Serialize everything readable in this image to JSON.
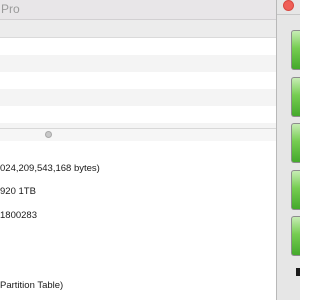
{
  "window": {
    "title": "Pro"
  },
  "info": {
    "lines": [
      "024,209,543,168 bytes)",
      "920 1TB",
      "1800283",
      " Partition Table)"
    ]
  },
  "side_panel": {
    "buttons": [
      "green-button-1",
      "green-button-2",
      "green-button-3",
      "green-button-4",
      "green-button-5"
    ],
    "accent": "#4fb535"
  },
  "colors": {
    "close": "#ef5f57",
    "header": "#ececec"
  }
}
